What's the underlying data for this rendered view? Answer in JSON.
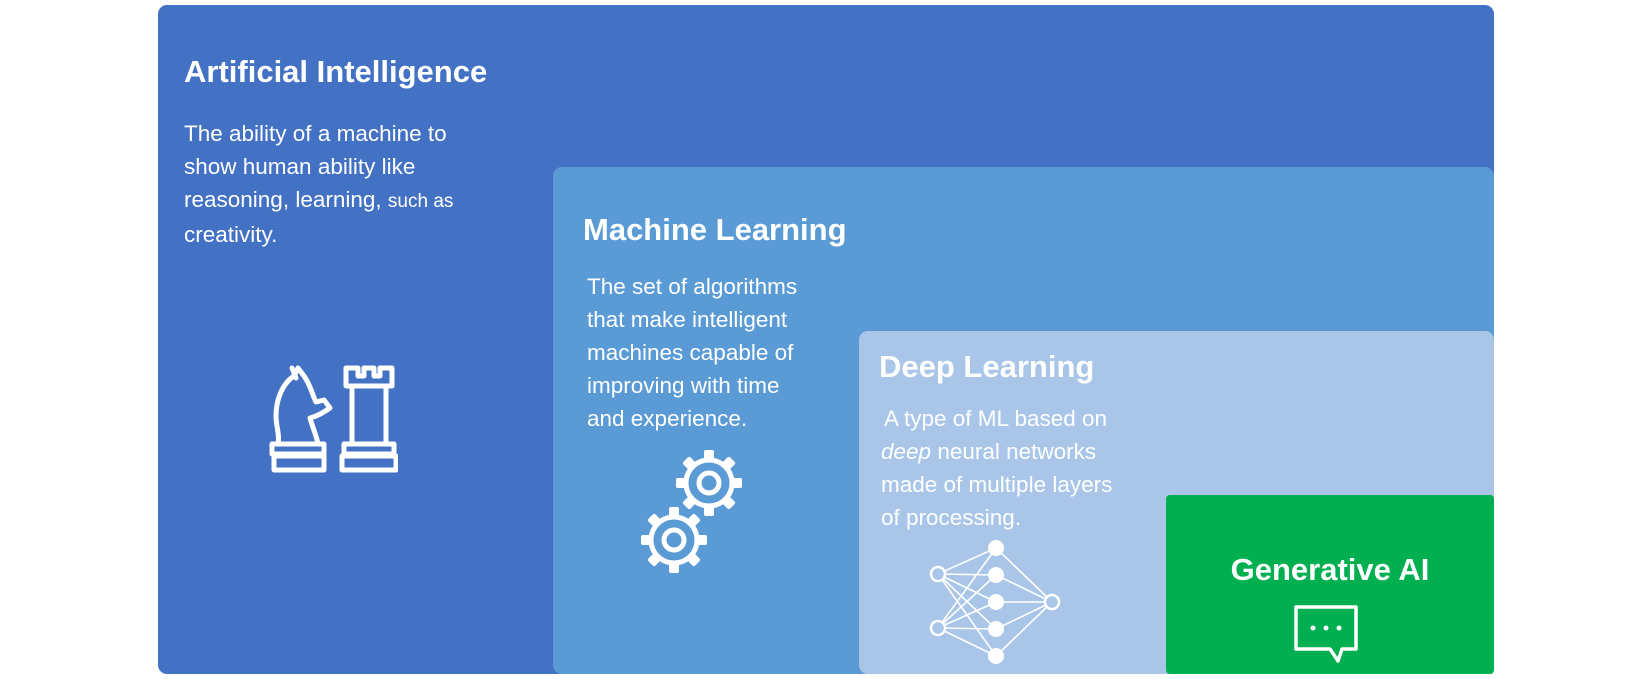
{
  "ai": {
    "title": "Artificial Intelligence",
    "desc_line1": "The ability of a machine to",
    "desc_line2": "show human ability like",
    "desc_line3a": "reasoning, learning,",
    "desc_line3b": "such as",
    "desc_line4": "creativity.",
    "icon": "chess-icon"
  },
  "ml": {
    "title": "Machine Learning",
    "desc_line1": "The set of algorithms",
    "desc_line2": "that make intelligent",
    "desc_line3": "machines capable of",
    "desc_line4": "improving with time",
    "desc_line5": "and experience.",
    "icon": "gears-icon"
  },
  "dl": {
    "title": "Deep Learning",
    "desc_line1": "A type of ML based on",
    "desc_line2_em": "deep",
    "desc_line2_rest": "neural networks",
    "desc_line3": "made of multiple layers",
    "desc_line4": "of processing.",
    "icon": "neural-network-icon"
  },
  "gen": {
    "title": "Generative AI",
    "icon": "chat-bubble-icon"
  },
  "colors": {
    "ai": "#4372C4",
    "ml": "#5B9BD5",
    "dl": "#A9C6E8",
    "gen": "#00AF50"
  }
}
